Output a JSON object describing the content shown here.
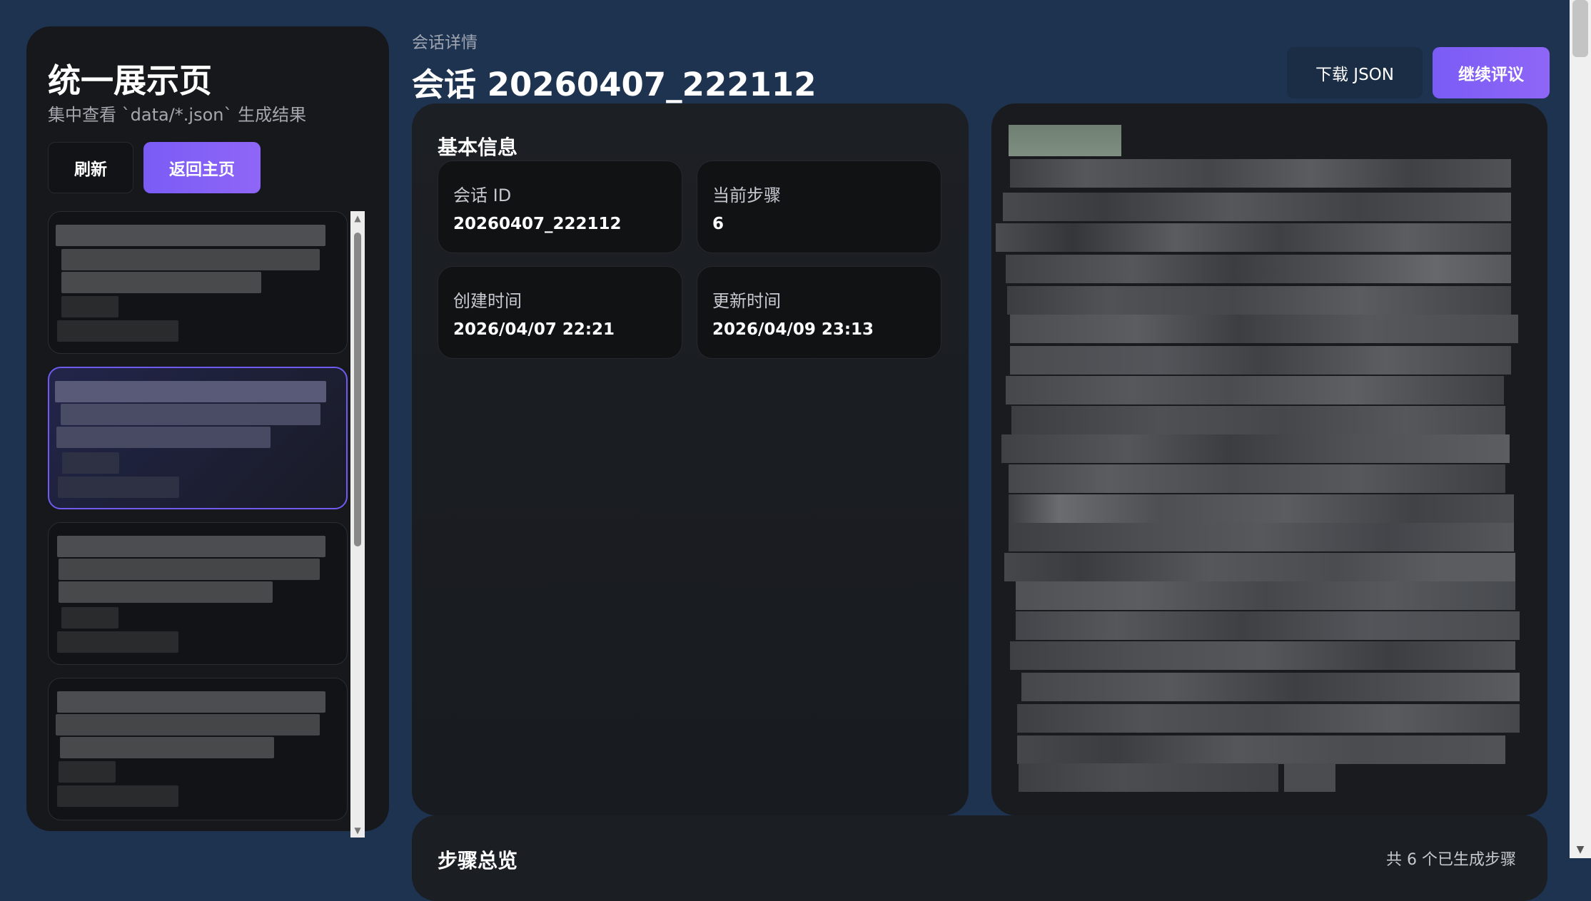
{
  "sidebar": {
    "title": "统一展示页",
    "subtitle": "集中查看 `data/*.json` 生成结果",
    "refresh_label": "刷新",
    "home_label": "返回主页",
    "items_count": 4
  },
  "header": {
    "breadcrumb": "会话详情",
    "title": "会话 20260407_222112",
    "download_label": "下载 JSON",
    "continue_label": "继续评议"
  },
  "info": {
    "heading": "基本信息",
    "fields": [
      {
        "label": "会话 ID",
        "value": "20260407_222112"
      },
      {
        "label": "当前步骤",
        "value": "6"
      },
      {
        "label": "创建时间",
        "value": "2026/04/07 22:21"
      },
      {
        "label": "更新时间",
        "value": "2026/04/09 23:13"
      }
    ]
  },
  "steps": {
    "heading": "步骤总览",
    "summary": "共 6 个已生成步骤"
  },
  "colors": {
    "accent": "#7a5cf5",
    "background": "#1e3350",
    "panel": "#1b1e22"
  },
  "icons": {
    "scroll_up": "▲",
    "scroll_down": "▼"
  }
}
